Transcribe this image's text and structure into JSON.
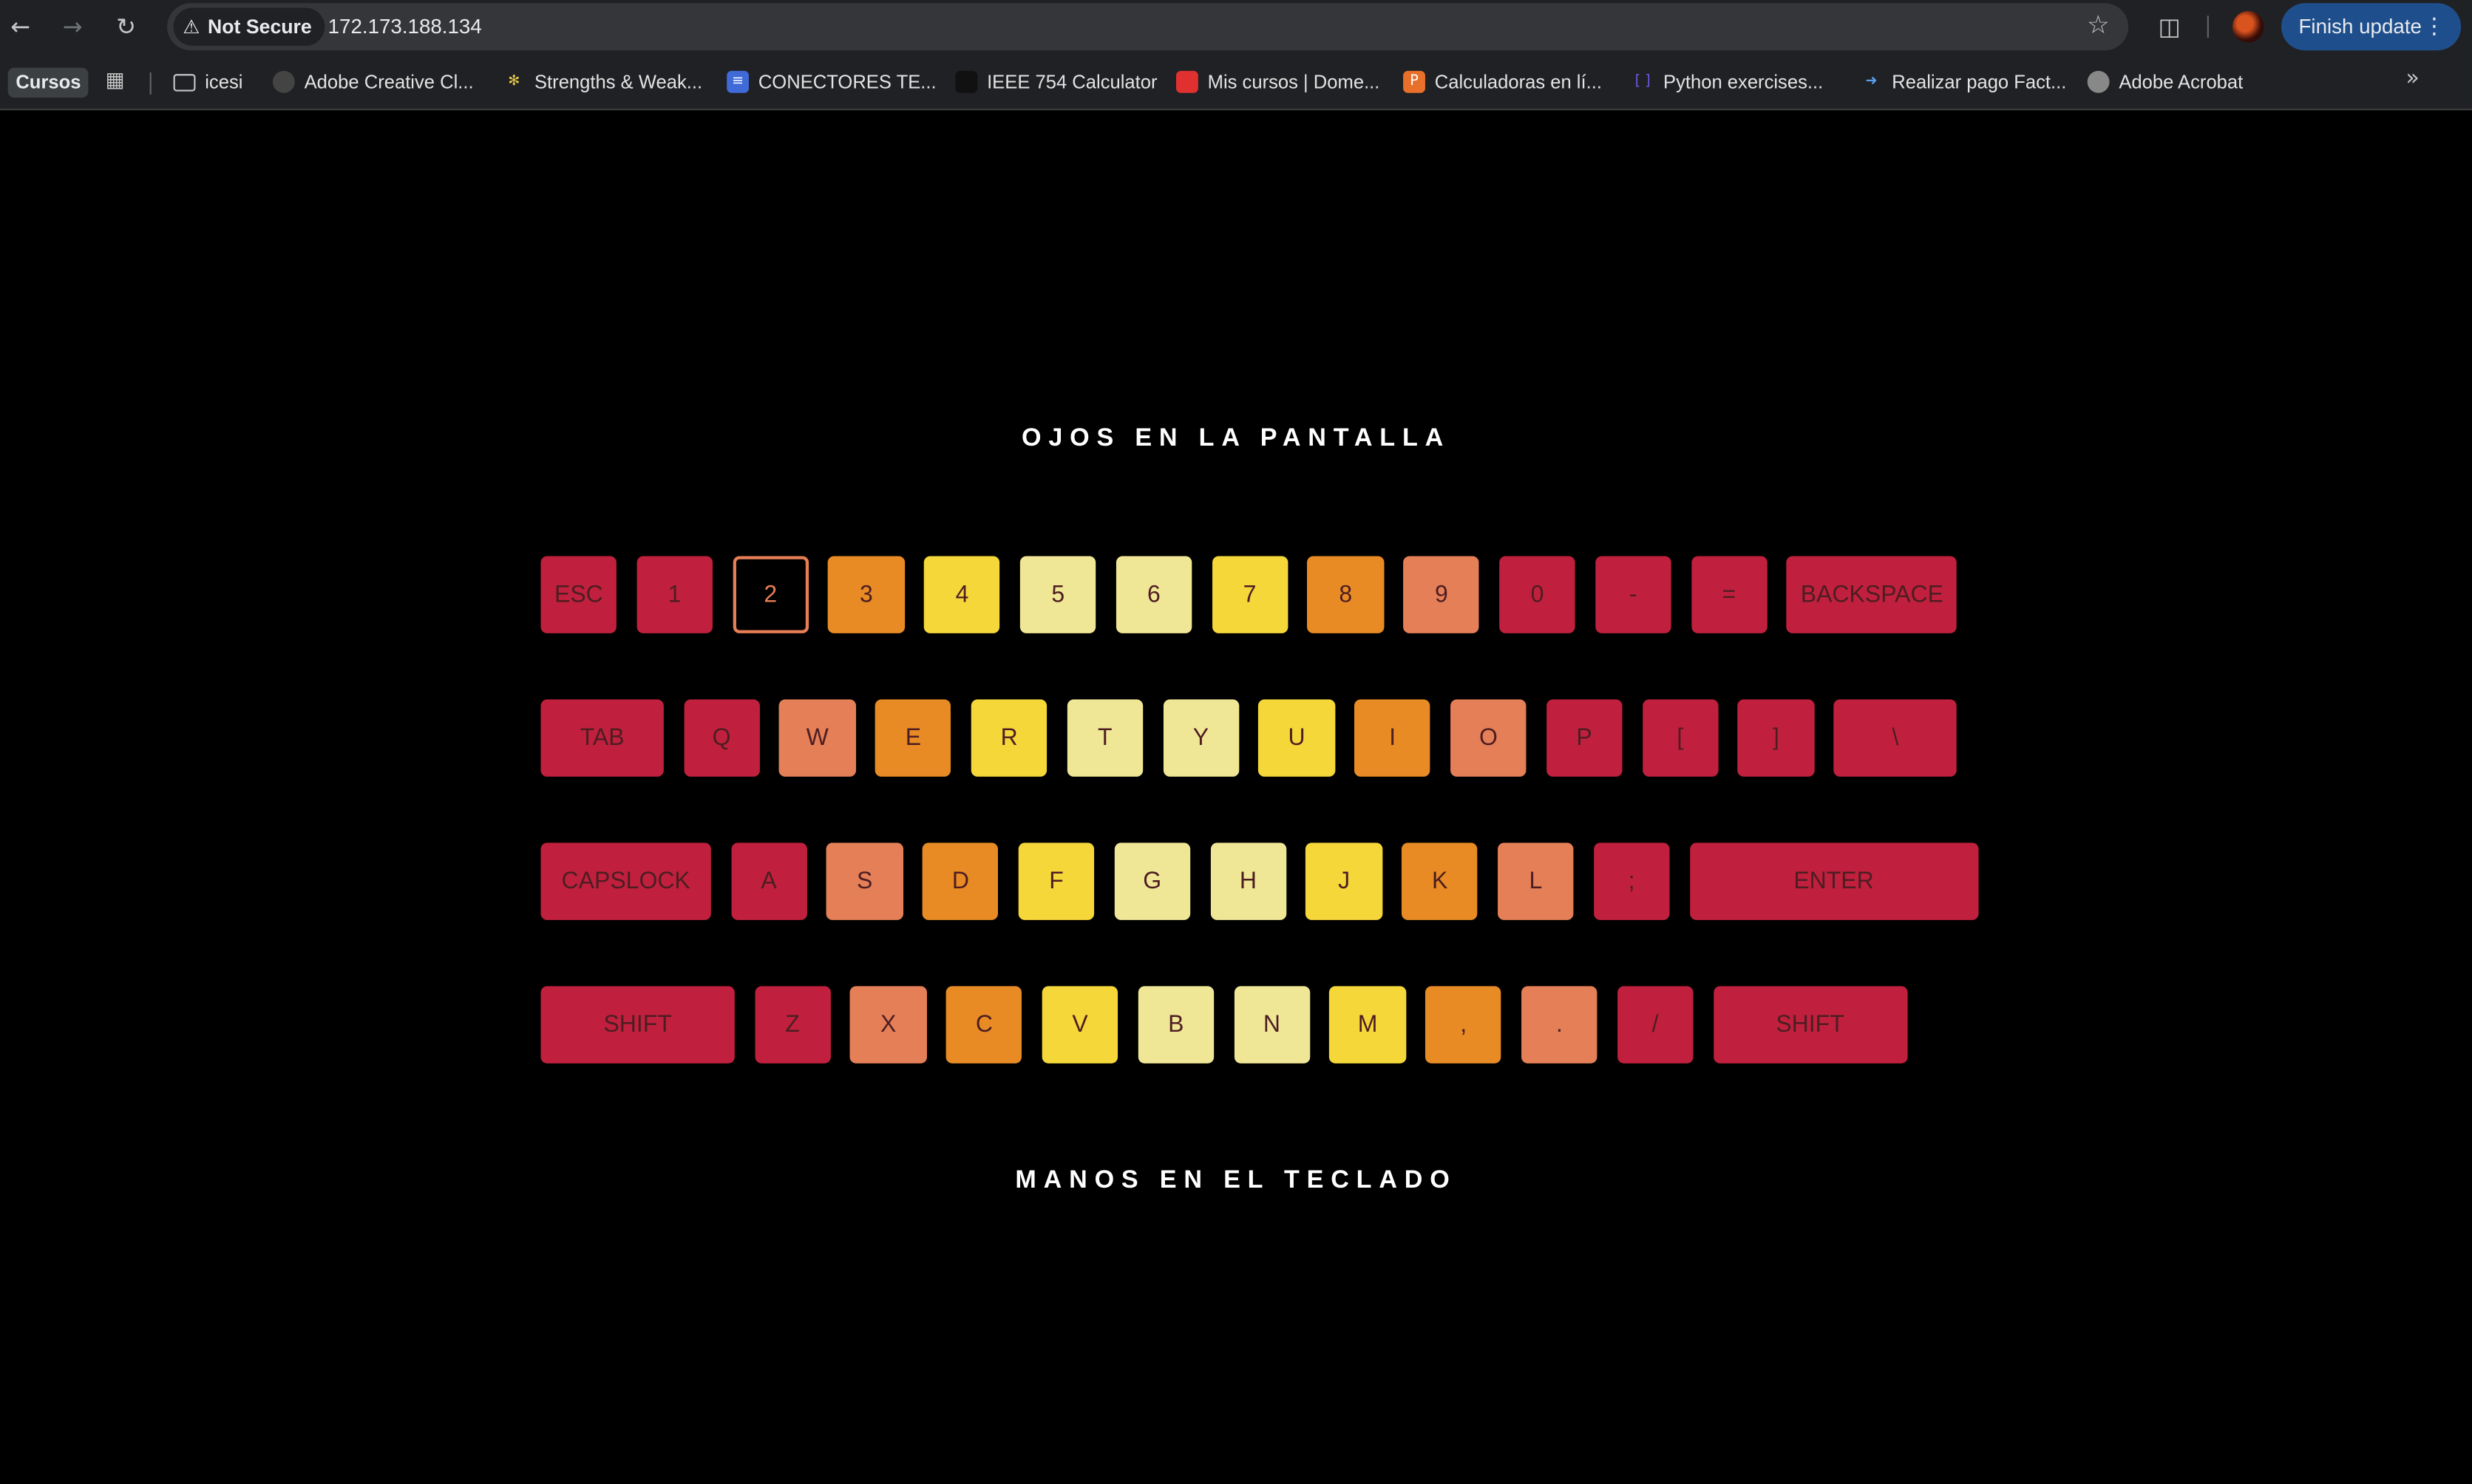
{
  "browser": {
    "security_label": "Not Secure",
    "url": "172.173.188.134",
    "finish_update": "Finish update"
  },
  "bookmarks": {
    "profile_chip": "Cursos",
    "items": [
      {
        "label": "icesi",
        "icon": "folder-icon"
      },
      {
        "label": "Adobe Creative Cl...",
        "icon": "creative-cloud-icon"
      },
      {
        "label": "Strengths & Weak...",
        "icon": "sparkle-icon"
      },
      {
        "label": "CONECTORES TE...",
        "icon": "doc-icon"
      },
      {
        "label": "IEEE 754 Calculator",
        "icon": "car-icon"
      },
      {
        "label": "Mis cursos | Dome...",
        "icon": "domestika-icon"
      },
      {
        "label": "Calculadoras en lí...",
        "icon": "calc-icon"
      },
      {
        "label": "Python exercises...",
        "icon": "bracket-icon"
      },
      {
        "label": "Realizar pago Fact...",
        "icon": "arrow-icon"
      },
      {
        "label": "Adobe Acrobat",
        "icon": "globe-icon"
      }
    ]
  },
  "page": {
    "title_top": "OJOS EN LA PANTALLA",
    "title_bottom": "MANOS EN EL TECLADO",
    "colors": {
      "red": "#c0203d",
      "salmon": "#e57f57",
      "orange": "#e88b24",
      "yellow": "#f5d73a",
      "pale": "#f0e796"
    },
    "keyboard_rows": [
      [
        {
          "label": "ESC",
          "color": "red"
        },
        {
          "label": "1",
          "color": "red"
        },
        {
          "label": "2",
          "color": "salmon",
          "active": true
        },
        {
          "label": "3",
          "color": "orange"
        },
        {
          "label": "4",
          "color": "yellow"
        },
        {
          "label": "5",
          "color": "pale"
        },
        {
          "label": "6",
          "color": "pale"
        },
        {
          "label": "7",
          "color": "yellow"
        },
        {
          "label": "8",
          "color": "orange"
        },
        {
          "label": "9",
          "color": "salmon"
        },
        {
          "label": "0",
          "color": "red"
        },
        {
          "label": "-",
          "color": "red"
        },
        {
          "label": "=",
          "color": "red"
        },
        {
          "label": "BACKSPACE",
          "color": "red"
        }
      ],
      [
        {
          "label": "TAB",
          "color": "red"
        },
        {
          "label": "Q",
          "color": "red"
        },
        {
          "label": "W",
          "color": "salmon"
        },
        {
          "label": "E",
          "color": "orange"
        },
        {
          "label": "R",
          "color": "yellow"
        },
        {
          "label": "T",
          "color": "pale"
        },
        {
          "label": "Y",
          "color": "pale"
        },
        {
          "label": "U",
          "color": "yellow"
        },
        {
          "label": "I",
          "color": "orange"
        },
        {
          "label": "O",
          "color": "salmon"
        },
        {
          "label": "P",
          "color": "red"
        },
        {
          "label": "[",
          "color": "red"
        },
        {
          "label": "]",
          "color": "red"
        },
        {
          "label": "\\",
          "color": "red"
        }
      ],
      [
        {
          "label": "CAPSLOCK",
          "color": "red"
        },
        {
          "label": "A",
          "color": "red"
        },
        {
          "label": "S",
          "color": "salmon"
        },
        {
          "label": "D",
          "color": "orange"
        },
        {
          "label": "F",
          "color": "yellow"
        },
        {
          "label": "G",
          "color": "pale"
        },
        {
          "label": "H",
          "color": "pale"
        },
        {
          "label": "J",
          "color": "yellow"
        },
        {
          "label": "K",
          "color": "orange"
        },
        {
          "label": "L",
          "color": "salmon"
        },
        {
          "label": ";",
          "color": "red"
        },
        {
          "label": "ENTER",
          "color": "red"
        }
      ],
      [
        {
          "label": "SHIFT",
          "color": "red"
        },
        {
          "label": "Z",
          "color": "red"
        },
        {
          "label": "X",
          "color": "salmon"
        },
        {
          "label": "C",
          "color": "orange"
        },
        {
          "label": "V",
          "color": "yellow"
        },
        {
          "label": "B",
          "color": "pale"
        },
        {
          "label": "N",
          "color": "pale"
        },
        {
          "label": "M",
          "color": "yellow"
        },
        {
          "label": ",",
          "color": "orange"
        },
        {
          "label": ".",
          "color": "salmon"
        },
        {
          "label": "/",
          "color": "red"
        },
        {
          "label": "SHIFT",
          "color": "red"
        }
      ]
    ]
  }
}
